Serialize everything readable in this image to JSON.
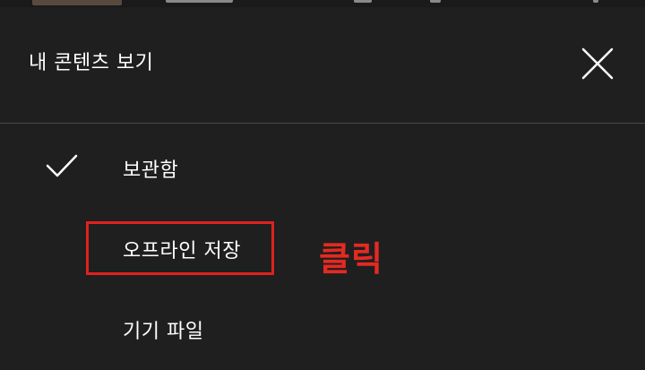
{
  "header": {
    "title": "내 콘텐츠 보기",
    "close_icon": "close-icon"
  },
  "menu": {
    "items": [
      {
        "label": "보관함",
        "selected": true
      },
      {
        "label": "오프라인 저장",
        "selected": false
      },
      {
        "label": "기기 파일",
        "selected": false
      }
    ]
  },
  "annotation": {
    "text": "클릭",
    "color": "#e42a22"
  },
  "colors": {
    "background": "#1f1f1f",
    "divider": "#4a4a4a",
    "highlight": "#e0211f"
  }
}
